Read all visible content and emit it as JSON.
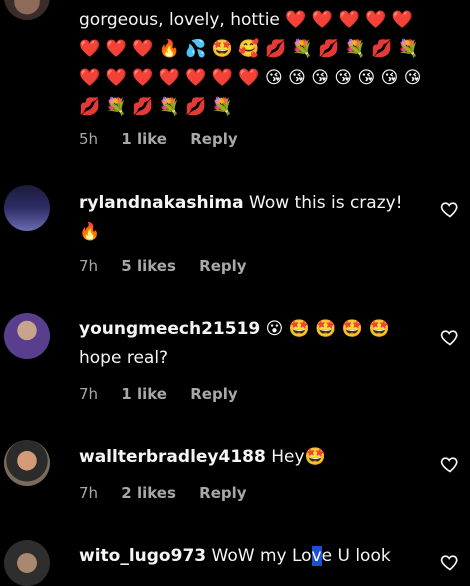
{
  "comments": [
    {
      "user": "",
      "text": "gorgeous, lovely, hottie ❤️ ❤️ ❤️ ❤️ ❤️ ❤️ ❤️ ❤️ 🔥 💦 🤩 🥰 💋 💐 💋 💐 💋 💐 ❤️ ❤️ ❤️ ❤️ ❤️ ❤️ ❤️ 😘 😘 😘 😘 😘 😘 😘 💋 💐 💋 💐 💋 💐",
      "time": "5h",
      "likes": "1 like",
      "reply": "Reply"
    },
    {
      "user": "rylandnakashima",
      "text": "Wow this is crazy! 🔥",
      "time": "7h",
      "likes": "5 likes",
      "reply": "Reply"
    },
    {
      "user": "youngmeech21519",
      "text": "😮 🤩 🤩 🤩 🤩 hope real?",
      "time": "7h",
      "likes": "1 like",
      "reply": "Reply"
    },
    {
      "user": "wallterbradley4188",
      "text": "Hey🤩",
      "time": "7h",
      "likes": "2 likes",
      "reply": "Reply"
    },
    {
      "user": "wito_lugo973",
      "text_before": "WoW my Lo",
      "text_highlight": "v",
      "text_after": "e U look",
      "time": "",
      "likes": "",
      "reply": ""
    }
  ],
  "colors": {
    "background": "#000000",
    "text": "#f5f5f5",
    "meta": "#a8a8a8",
    "selection": "#1a4fd6"
  }
}
